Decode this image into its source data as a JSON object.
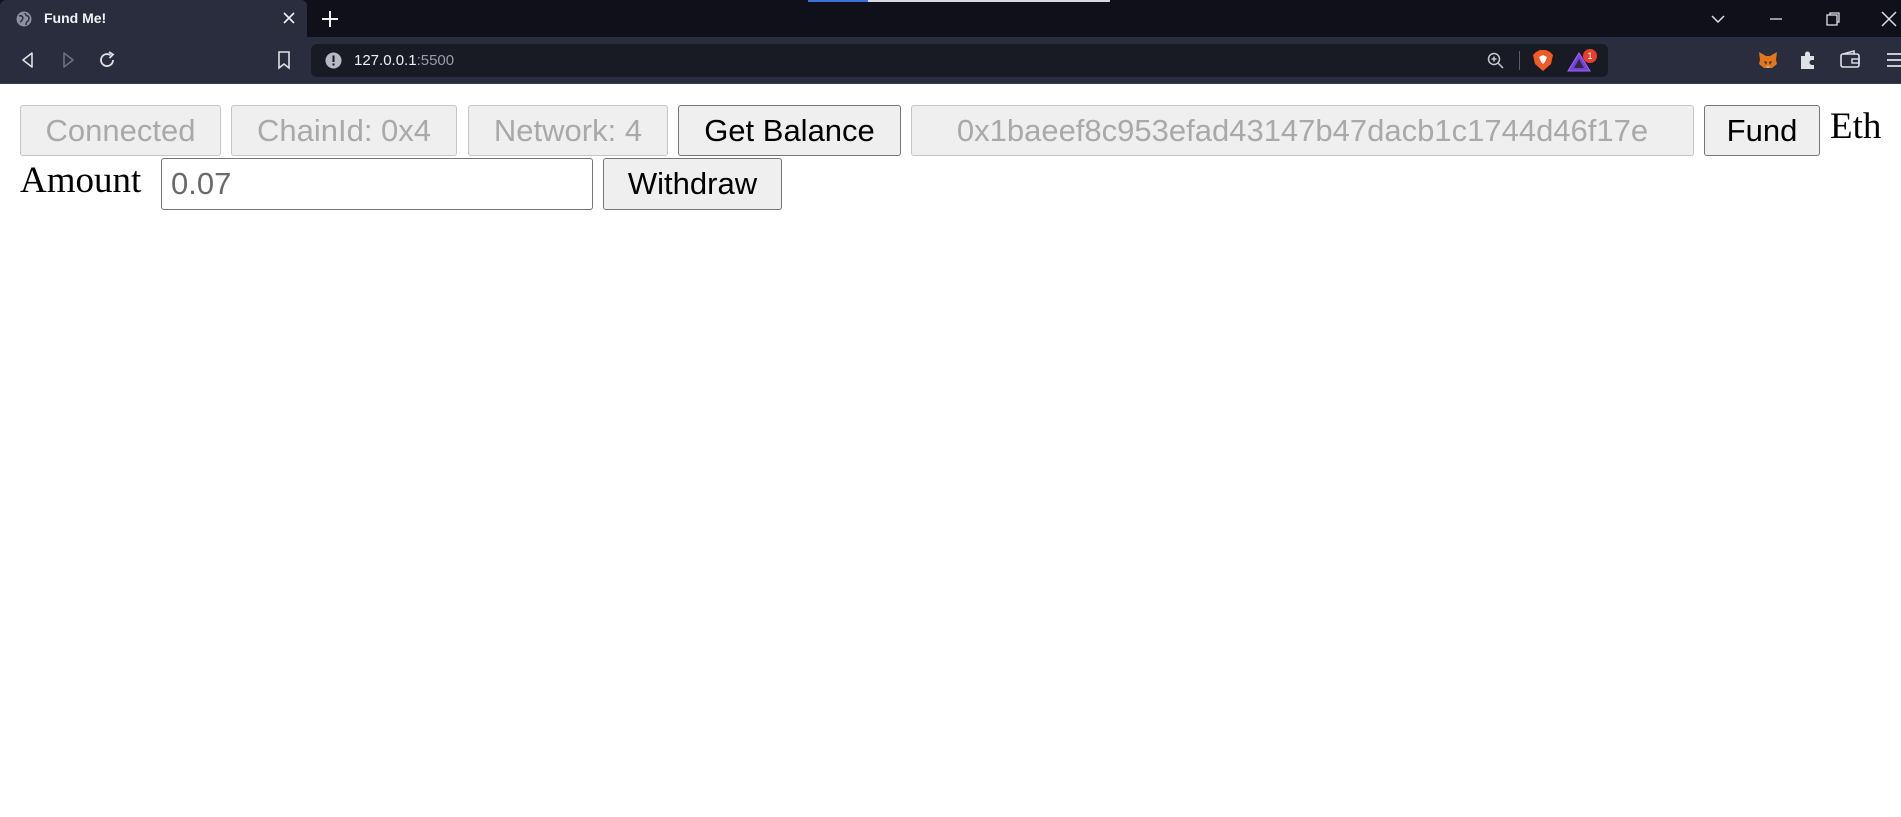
{
  "browser": {
    "tab": {
      "title": "Fund Me!"
    },
    "address_bar": {
      "host": "127.0.0.1",
      "port": ":5500"
    },
    "rewards_badge": "1"
  },
  "page": {
    "buttons": {
      "connect": "Connected",
      "chain_id": "ChainId: 0x4",
      "network": "Network: 4",
      "get_balance": "Get Balance",
      "account": "0x1baeef8c953efad43147b47dacb1c1744d46f17e",
      "fund": "Fund",
      "withdraw": "Withdraw"
    },
    "eth_amount_label_line1": "Eth",
    "eth_amount_label_line2": "Amount",
    "eth_amount_input": {
      "value": "0.07"
    }
  },
  "colors": {
    "tabbar_bg": "#0f101a",
    "toolbar_bg": "#2a2d3e",
    "button_bg": "#efefef",
    "disabled_text": "#a9a9a9"
  }
}
